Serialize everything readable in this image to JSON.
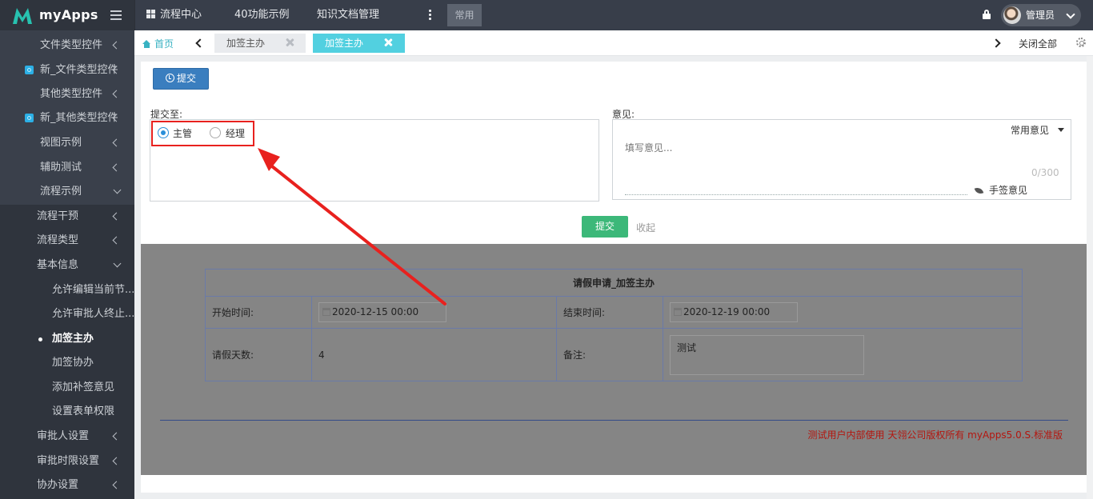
{
  "app": {
    "name": "myApps"
  },
  "topnav": {
    "items": [
      {
        "label": "流程中心"
      },
      {
        "label": "40功能示例"
      },
      {
        "label": "知识文档管理"
      }
    ],
    "changyong": "常用",
    "user_name": "管理员"
  },
  "sidebar": {
    "items": [
      {
        "label": "文件类型控件",
        "icon": "",
        "chevron": "left"
      },
      {
        "label": "新_文件类型控件",
        "icon": "widget-square-icon",
        "chevron": "left"
      },
      {
        "label": "其他类型控件",
        "icon": "",
        "chevron": "left"
      },
      {
        "label": "新_其他类型控件",
        "icon": "widget-square-icon",
        "chevron": "left"
      },
      {
        "label": "视图示例",
        "icon": "",
        "chevron": "left"
      },
      {
        "label": "辅助测试",
        "icon": "",
        "chevron": "left"
      },
      {
        "label": "流程示例",
        "icon": "",
        "chevron": "down"
      },
      {
        "label": "流程干预",
        "icon": "",
        "chevron": "left"
      },
      {
        "label": "流程类型",
        "icon": "",
        "chevron": "left"
      },
      {
        "label": "基本信息",
        "icon": "",
        "chevron": "down"
      },
      {
        "label": "允许编辑当前节..."
      },
      {
        "label": "允许审批人终止..."
      },
      {
        "label": "加签主办",
        "active": true
      },
      {
        "label": "加签协办"
      },
      {
        "label": "添加补签意见"
      },
      {
        "label": "设置表单权限"
      },
      {
        "label": "审批人设置",
        "chevron": "left"
      },
      {
        "label": "审批时限设置",
        "chevron": "left"
      },
      {
        "label": "协办设置",
        "chevron": "left"
      }
    ]
  },
  "tabs": {
    "home": "首页",
    "items": [
      {
        "label": "加签主办"
      },
      {
        "label": "加签主办",
        "active": true
      }
    ],
    "close_all": "关闭全部"
  },
  "submit_panel": {
    "top_button": "提交",
    "submit_to_label": "提交至:",
    "options": [
      {
        "label": "主管",
        "selected": true
      },
      {
        "label": "经理",
        "selected": false
      }
    ],
    "opinion_label": "意见:",
    "common_opinion": "常用意见",
    "opinion_placeholder": "填写意见...",
    "counter": "0/300",
    "handwrite": "手签意见",
    "submit_button": "提交",
    "collapse": "收起"
  },
  "form": {
    "title": "请假申请_加签主办",
    "start_label": "开始时间:",
    "start_value": "2020-12-15 00:00",
    "end_label": "结束时间:",
    "end_value": "2020-12-19 00:00",
    "days_label": "请假天数:",
    "days_value": "4",
    "remark_label": "备注:",
    "remark_value": "测试"
  },
  "footer": {
    "text": "测试用户内部使用 天翎公司版权所有 myApps5.0.S.标准版"
  },
  "colors": {
    "accent": "#52d0e0",
    "primary_button": "#3a7ebf",
    "submit_green": "#3cb879",
    "annotation_red": "#e8211e",
    "sidebar_bg": "#2f343d"
  }
}
